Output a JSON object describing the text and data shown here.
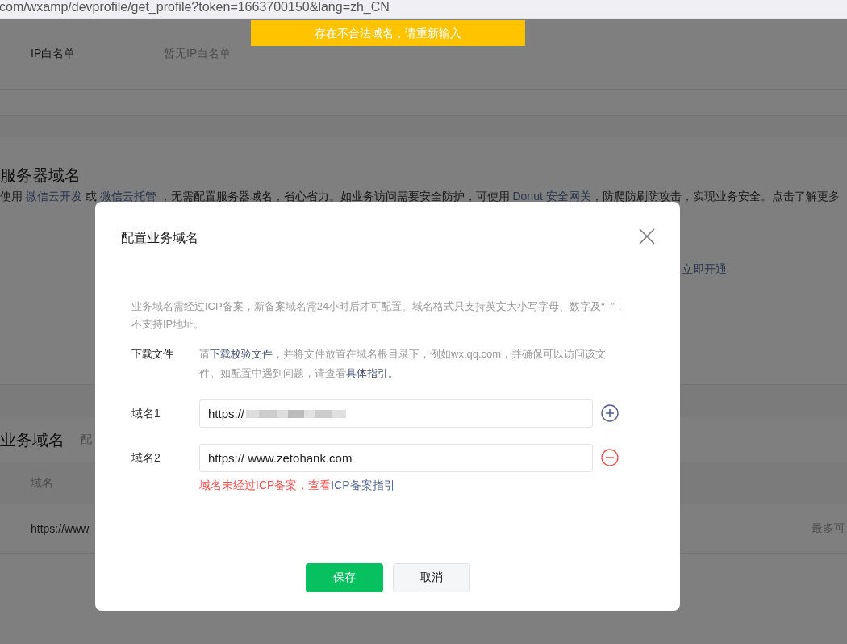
{
  "browser": {
    "url": "com/wxamp/devprofile/get_profile?token=1663700150&lang=zh_CN"
  },
  "toast": {
    "text": "存在不合法域名，请重新输入"
  },
  "page": {
    "ip_whitelist": {
      "label": "IP白名单",
      "value": "暂无IP白名单"
    },
    "server_domain": {
      "title": "服务器域名",
      "description": [
        {
          "text": "使用 "
        },
        {
          "text": "微信云开发",
          "link": true
        },
        {
          "text": " 或 "
        },
        {
          "text": "微信云托管",
          "link": true
        },
        {
          "text": " ，无需配置服务器域名，省心省力。如业务访问需要安全防护，可使用 "
        },
        {
          "text": "Donut 安全网关",
          "link": true
        },
        {
          "text": "，防爬防刷防攻击，实现业务安全。点击了解更多"
        }
      ],
      "action": "立即开通"
    },
    "business_domain": {
      "title": "业务域名",
      "subtitle": "配",
      "table": {
        "columns": [
          "域名"
        ],
        "rows": [
          {
            "cells": [
              "https://www"
            ],
            "note": "最多可"
          }
        ]
      }
    }
  },
  "dialog": {
    "title": "配置业务域名",
    "notice": "业务域名需经过ICP备案，新备案域名需24小时后才可配置。域名格式只支持英文大小写字母、数字及“- ”，不支持IP地址。",
    "download": {
      "label": "下载文件",
      "text": [
        {
          "text": "请"
        },
        {
          "text": "下载校验文件",
          "link": true
        },
        {
          "text": "，并将文件放置在域名根目录下，例如wx.qq.com，并确保可以访问该文件。如配置中遇到问题，请查看"
        },
        {
          "text": "具体指引。",
          "link": true
        }
      ]
    },
    "fields": [
      {
        "label": "域名1",
        "value": "https://",
        "redacted": true,
        "kind": "add"
      },
      {
        "label": "域名2",
        "value": "https:// www.zetohank.com",
        "redacted": false,
        "kind": "remove",
        "error": "域名未经过ICP备案，查看",
        "error_link": "ICP备案指引"
      }
    ],
    "buttons": [
      {
        "label": "保存",
        "kind": "primary"
      },
      {
        "label": "取消",
        "kind": "secondary"
      }
    ]
  }
}
